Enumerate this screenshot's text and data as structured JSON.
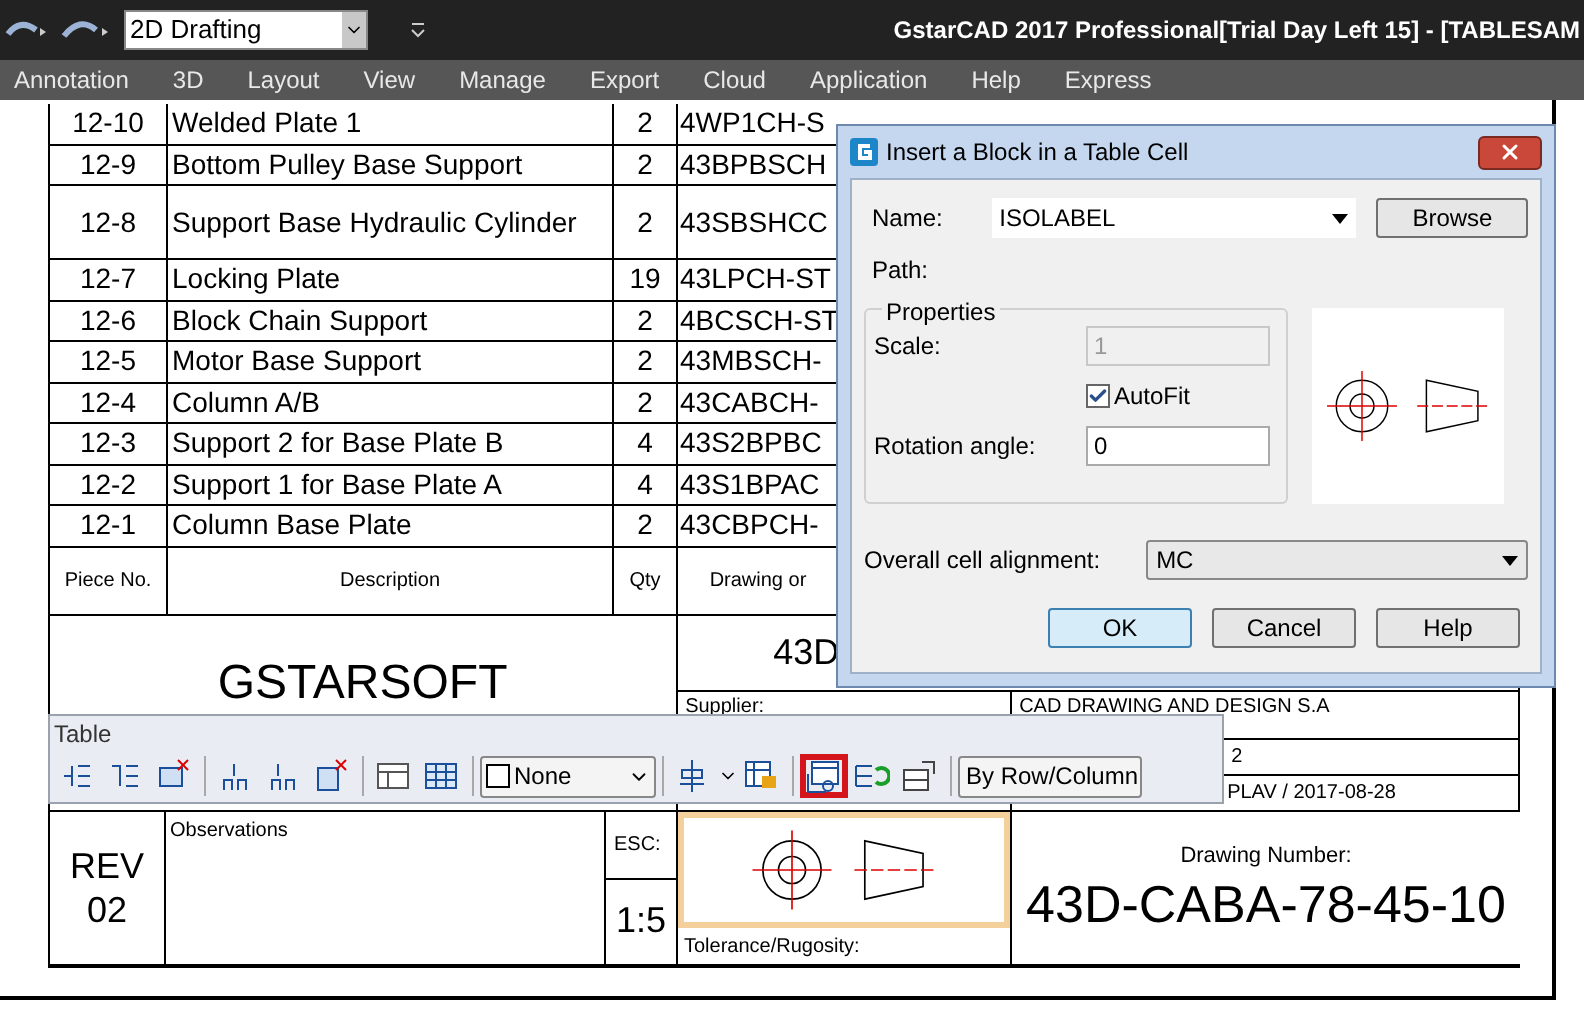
{
  "title_bar": {
    "workspace": "2D Drafting",
    "title": "GstarCAD 2017 Professional[Trial Day Left 15] - [TABLESAM"
  },
  "menu": [
    "Annotation",
    "3D",
    "Layout",
    "View",
    "Manage",
    "Export",
    "Cloud",
    "Application",
    "Help",
    "Express"
  ],
  "parts_table": {
    "rows": [
      {
        "piece": "12-10",
        "description": "Welded Plate 1",
        "qty": "2",
        "drawing": "4WP1CH-S"
      },
      {
        "piece": "12-9",
        "description": "Bottom Pulley Base Support",
        "qty": "2",
        "drawing": "43BPBSCH"
      },
      {
        "piece": "12-8",
        "description": "Support Base Hydraulic Cylinder",
        "qty": "2",
        "drawing": "43SBSHCC",
        "tall": true
      },
      {
        "piece": "12-7",
        "description": "Locking Plate",
        "qty": "19",
        "drawing": "43LPCH-ST"
      },
      {
        "piece": "12-6",
        "description": "Block Chain Support",
        "qty": "2",
        "drawing": "4BCSCH-ST"
      },
      {
        "piece": "12-5",
        "description": "Motor Base Support",
        "qty": "2",
        "drawing": "43MBSCH-"
      },
      {
        "piece": "12-4",
        "description": "Column A/B",
        "qty": "2",
        "drawing": "43CABCH-"
      },
      {
        "piece": "12-3",
        "description": "Support 2 for Base Plate B",
        "qty": "4",
        "drawing": "43S2BPBC"
      },
      {
        "piece": "12-2",
        "description": "Support 1 for Base Plate A",
        "qty": "4",
        "drawing": "43S1BPAC"
      },
      {
        "piece": "12-1",
        "description": "Column Base Plate",
        "qty": "2",
        "drawing": "43CBPCH-"
      }
    ],
    "header": {
      "piece": "Piece No.",
      "description": "Description",
      "qty": "Qty",
      "drawing": "Drawing or"
    }
  },
  "title_block": {
    "company": "GSTARSOFT",
    "code": "43D",
    "supplier_label": "Supplier:",
    "supplier": "CAD DRAWING AND DESIGN S.A",
    "field_2": "2",
    "field_3": "PLAV / 2017-08-28",
    "rev_label": "REV",
    "rev": "02",
    "observations": "Observations",
    "scale_label": "ESC:",
    "scale": "1:5",
    "tolerance": "Tolerance/Rugosity:",
    "drawing_number_label": "Drawing Number:",
    "drawing_number": "43D-CABA-78-45-10"
  },
  "table_toolbar": {
    "title": "Table",
    "border_dropdown": "None",
    "mode_dropdown": "By Row/Column",
    "tools": [
      {
        "highlighted": false
      },
      {
        "highlighted": false
      },
      {
        "highlighted": false
      },
      {
        "highlighted": false
      },
      {
        "highlighted": false
      },
      {
        "highlighted": false
      },
      {
        "highlighted": false
      },
      {
        "highlighted": false
      },
      {
        "highlighted": false
      },
      {
        "highlighted": false
      },
      {
        "highlighted": true
      },
      {
        "highlighted": false
      },
      {
        "highlighted": false
      }
    ]
  },
  "dialog": {
    "title": "Insert a Block in a Table Cell",
    "name_label": "Name:",
    "name_value": "ISOLABEL",
    "browse": "Browse",
    "path_label": "Path:",
    "properties": "Properties",
    "scale_label": "Scale:",
    "scale_value": "1",
    "scale_disabled": true,
    "autofit_label": "AutoFit",
    "autofit_checked": true,
    "rotation_label": "Rotation angle:",
    "rotation_value": "0",
    "alignment_label": "Overall cell alignment:",
    "alignment_value": "MC",
    "buttons": [
      {
        "label": "OK",
        "default": true
      },
      {
        "label": "Cancel",
        "default": false
      },
      {
        "label": "Help",
        "default": false
      }
    ]
  }
}
